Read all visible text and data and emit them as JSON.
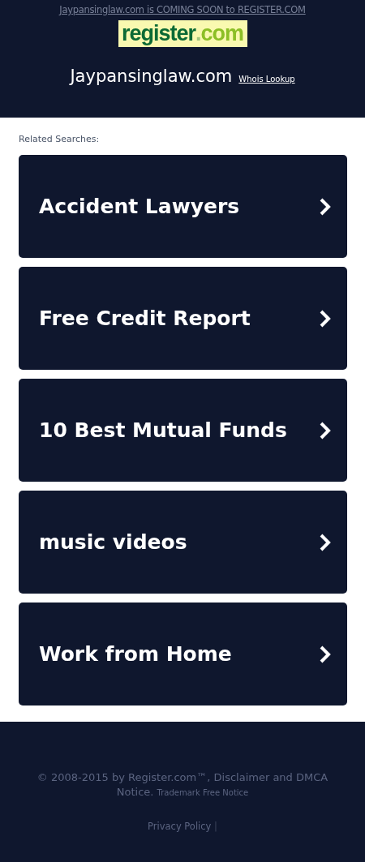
{
  "banner": {
    "text": "Jaypansinglaw.com is COMING SOON to REGISTER.COM"
  },
  "logo": {
    "name": "register",
    "dot": ".",
    "tld": "com"
  },
  "domain": {
    "title": "Jaypansinglaw.com",
    "whois_link": "Whois Lookup"
  },
  "related": {
    "heading": "Related Searches:",
    "items": [
      {
        "label": "Accident Lawyers"
      },
      {
        "label": "Free Credit Report"
      },
      {
        "label": "10 Best Mutual Funds"
      },
      {
        "label": "music videos"
      },
      {
        "label": "Work from Home"
      }
    ]
  },
  "footer": {
    "copyright": "© 2008-2015 by Register.com™, Disclaimer and DMCA Notice.",
    "trademark_link": "Trademark Free Notice",
    "privacy_link": "Privacy Policy",
    "separator": "|"
  }
}
